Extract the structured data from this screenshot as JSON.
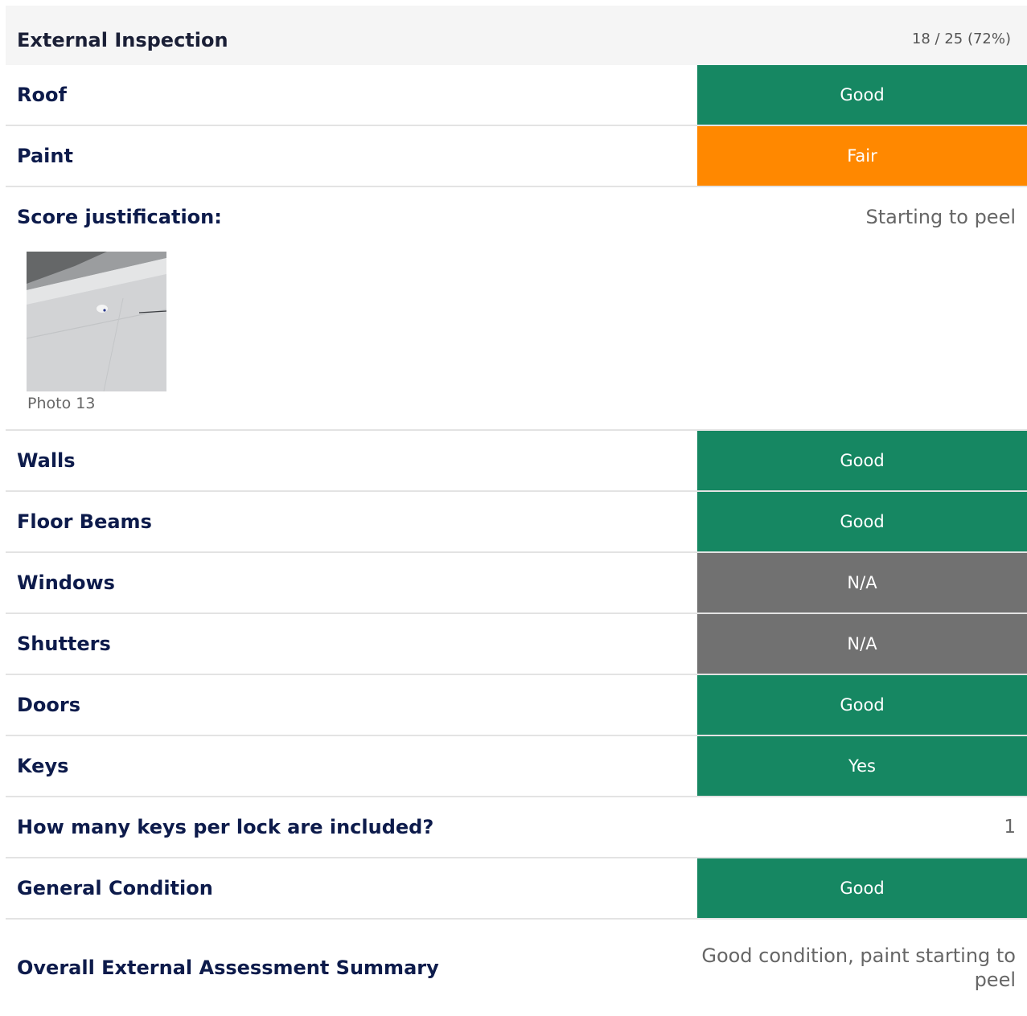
{
  "section": {
    "title": "External Inspection",
    "score": "18 / 25 (72%)"
  },
  "rows_top": [
    {
      "label": "Roof",
      "status": "Good",
      "status_type": "good"
    },
    {
      "label": "Paint",
      "status": "Fair",
      "status_type": "fair"
    }
  ],
  "justification": {
    "label": "Score justification:",
    "value": "Starting to peel",
    "photo_caption": "Photo 13"
  },
  "rows_bottom": [
    {
      "label": "Walls",
      "status": "Good",
      "status_type": "good"
    },
    {
      "label": "Floor Beams",
      "status": "Good",
      "status_type": "good"
    },
    {
      "label": "Windows",
      "status": "N/A",
      "status_type": "na"
    },
    {
      "label": "Shutters",
      "status": "N/A",
      "status_type": "na"
    },
    {
      "label": "Doors",
      "status": "Good",
      "status_type": "good"
    },
    {
      "label": "Keys",
      "status": "Yes",
      "status_type": "good"
    }
  ],
  "keys_per_lock": {
    "label": "How many keys per lock are included?",
    "value": "1"
  },
  "general_condition": {
    "label": "General Condition",
    "status": "Good",
    "status_type": "good"
  },
  "summary": {
    "label": "Overall External Assessment Summary",
    "value": "Good condition, paint starting to peel"
  },
  "colors": {
    "good": "#168762",
    "fair": "#ff8800",
    "na": "#717171"
  }
}
